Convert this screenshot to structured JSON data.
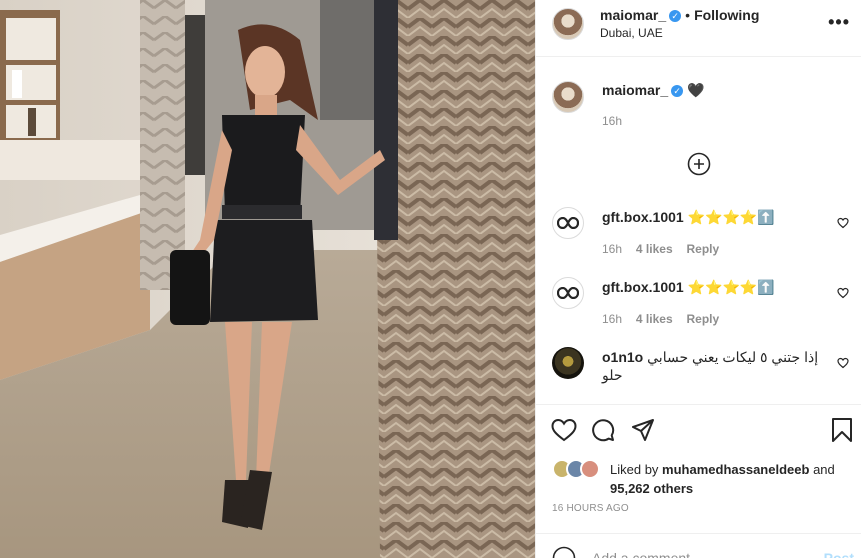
{
  "post": {
    "username": "maiomar_",
    "follow_status": "Following",
    "location": "Dubai, UAE",
    "verified_badge": "✓",
    "more_icon": "more-options-icon",
    "caption": {
      "username": "maiomar_",
      "emoji": "🖤",
      "time": "16h"
    }
  },
  "comments": [
    {
      "username": "gft.box.1001",
      "text": "⭐⭐⭐⭐⬆️",
      "time": "16h",
      "likes": "4 likes",
      "reply": "Reply"
    },
    {
      "username": "gft.box.1001",
      "text": "⭐⭐⭐⭐⬆️",
      "time": "16h",
      "likes": "4 likes",
      "reply": "Reply"
    },
    {
      "username": "o1n1o",
      "text": "إذا جتني ٥ ليكات يعني حسابي حلو"
    }
  ],
  "actions": {
    "like_icon": "heart-icon",
    "comment_icon": "comment-icon",
    "share_icon": "share-icon",
    "save_icon": "bookmark-icon"
  },
  "likes": {
    "prefix": "Liked by",
    "user": "muhamedhassaneldeeb",
    "and": "and",
    "count": "95,262 others"
  },
  "timestamp": "16 HOURS AGO",
  "add_comment": {
    "placeholder": "Add a comment...",
    "post_label": "Post"
  },
  "colors": {
    "link_blue": "#0095f6",
    "verified_blue": "#3897f0",
    "muted_gray": "#8e8e8e",
    "text": "#262626"
  }
}
